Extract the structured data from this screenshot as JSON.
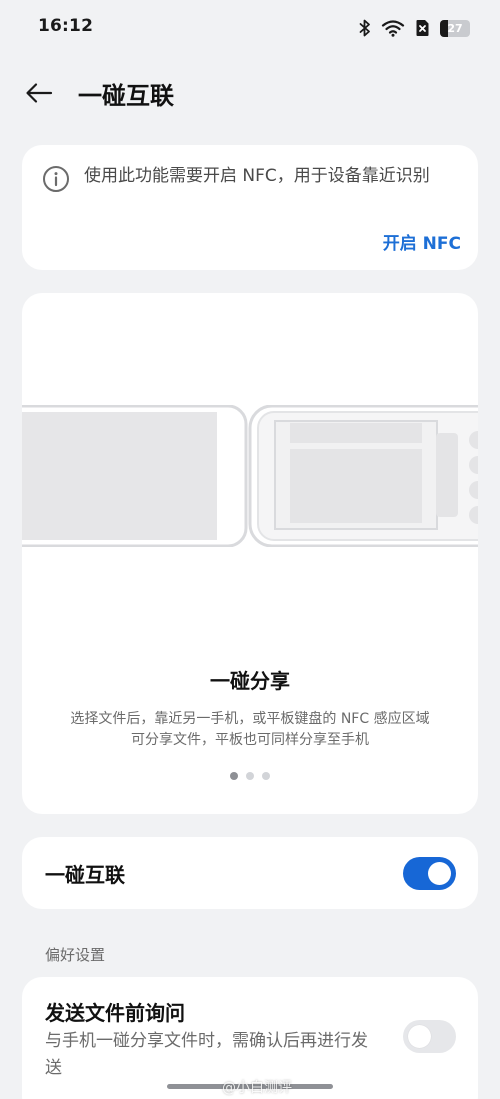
{
  "status_bar": {
    "time": "16:12",
    "icons": [
      "bluetooth-icon",
      "wifi-icon",
      "sim-icon"
    ],
    "battery_level": "27",
    "battery_fraction": 0.27
  },
  "header": {
    "back_icon": "arrow-left-icon",
    "title": "一碰互联"
  },
  "nfc_notice": {
    "icon": "info-icon",
    "text": "使用此功能需要开启 NFC，用于设备靠近识别",
    "action_label": "开启 NFC"
  },
  "carousel": {
    "title": "一碰分享",
    "description_line1": "选择文件后，靠近另一手机，或平板键盘的 NFC 感应区域",
    "description_line2": "可分享文件，平板也可同样分享至手机",
    "page_count": 3,
    "current_page": 1
  },
  "main_toggle": {
    "label": "一碰互联",
    "enabled": true
  },
  "preferences": {
    "section_label": "偏好设置",
    "ask_before_send": {
      "title": "发送文件前询问",
      "description": "与手机一碰分享文件时，需确认后再进行发送",
      "enabled": false
    }
  },
  "watermark": "@小白测评",
  "colors": {
    "accent": "#1767d6",
    "link": "#1d6fd6",
    "background": "#f1f2f4",
    "card": "#ffffff"
  }
}
